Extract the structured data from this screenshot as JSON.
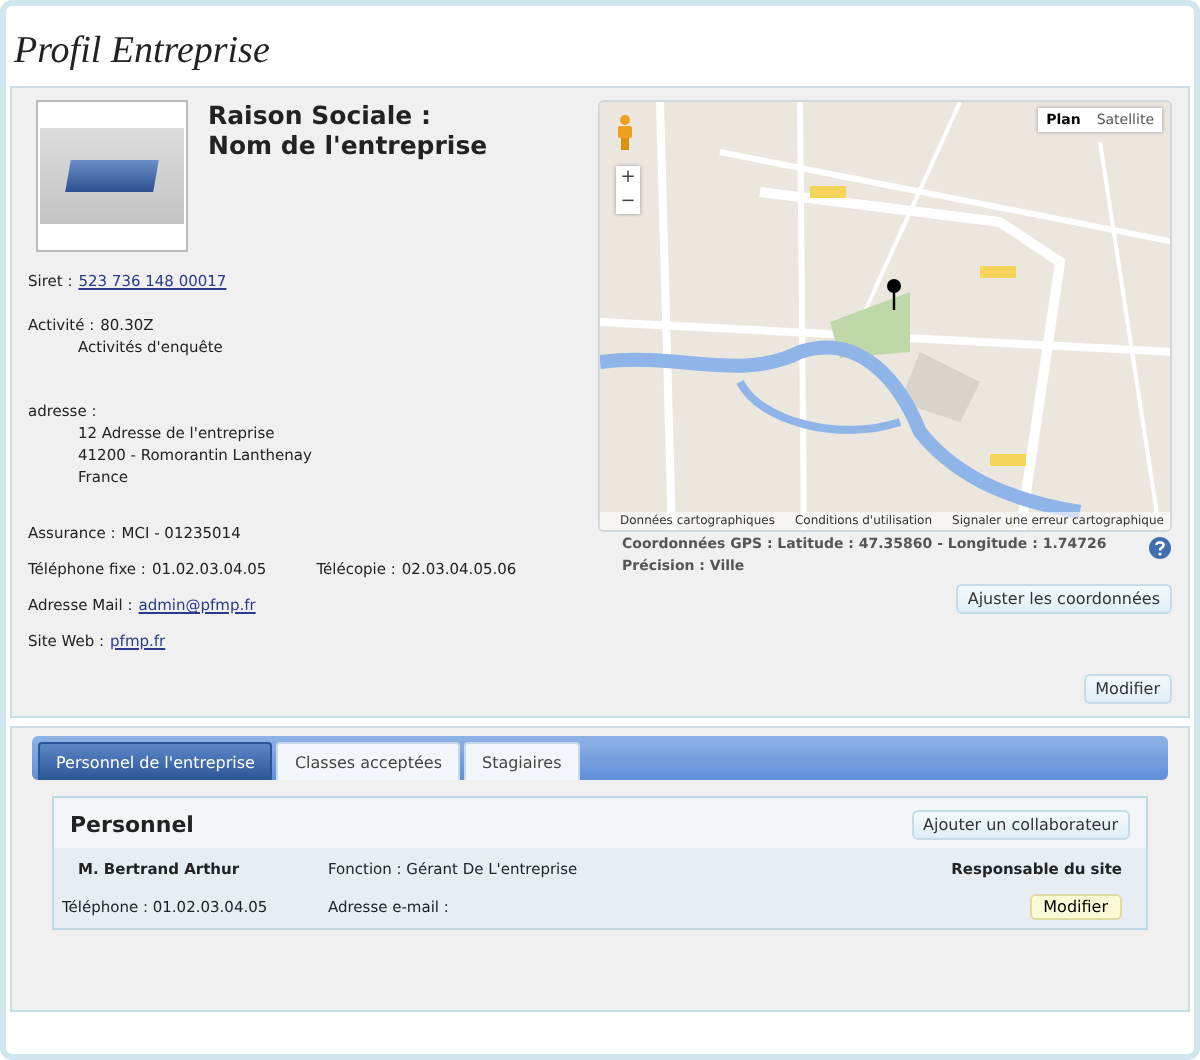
{
  "page_title": "Profil Entreprise",
  "company": {
    "heading_lines": [
      "Raison Sociale :",
      "Nom de l'entreprise"
    ],
    "fields": [
      {
        "kind": "link",
        "label": "Siret :",
        "value": "523 736 148 00017"
      },
      {
        "kind": "block",
        "label": "Activité :",
        "value": "80.30Z",
        "lines": [
          "Activités d'enquête"
        ]
      },
      {
        "kind": "block",
        "label": "adresse :",
        "lines": [
          "12 Adresse de l'entreprise",
          "41200 - Romorantin Lanthenay",
          "France"
        ]
      },
      {
        "kind": "text",
        "label": "Assurance :",
        "value": "MCI - 01235014"
      },
      {
        "kind": "pair",
        "label": "Téléphone fixe :",
        "value": "01.02.03.04.05",
        "label2": "Télécopie :",
        "value2": "02.03.04.05.06"
      },
      {
        "kind": "link",
        "label": "Adresse Mail :",
        "value": "admin@pfmp.fr"
      },
      {
        "kind": "link",
        "label": "Site Web :",
        "value": "pfmp.fr"
      }
    ]
  },
  "map": {
    "map_types": [
      {
        "label": "Plan",
        "selected": true
      },
      {
        "label": "Satellite",
        "selected": false
      }
    ],
    "zoom_in": "+",
    "zoom_out": "−",
    "attribution": [
      "Données cartographiques",
      "Conditions d'utilisation",
      "Signaler une erreur cartographique"
    ],
    "gps": "Coordonnées GPS : Latitude : 47.35860 - Longitude : 1.74726",
    "precision": "Précision : Ville",
    "adjust_button": "Ajuster les coordonnées"
  },
  "edit_button": "Modifier",
  "tabs": [
    {
      "label": "Personnel de l'entreprise",
      "selected": true
    },
    {
      "label": "Classes acceptées",
      "selected": false
    },
    {
      "label": "Stagiaires",
      "selected": false
    }
  ],
  "staff": {
    "title": "Personnel",
    "add_button": "Ajouter un collaborateur",
    "members": [
      {
        "name": "M. Bertrand Arthur",
        "function": "Fonction : Gérant De L'entreprise",
        "role": "Responsable du site",
        "phone": "Téléphone : 01.02.03.04.05",
        "email": "Adresse e-mail :",
        "button": "Modifier"
      }
    ]
  }
}
